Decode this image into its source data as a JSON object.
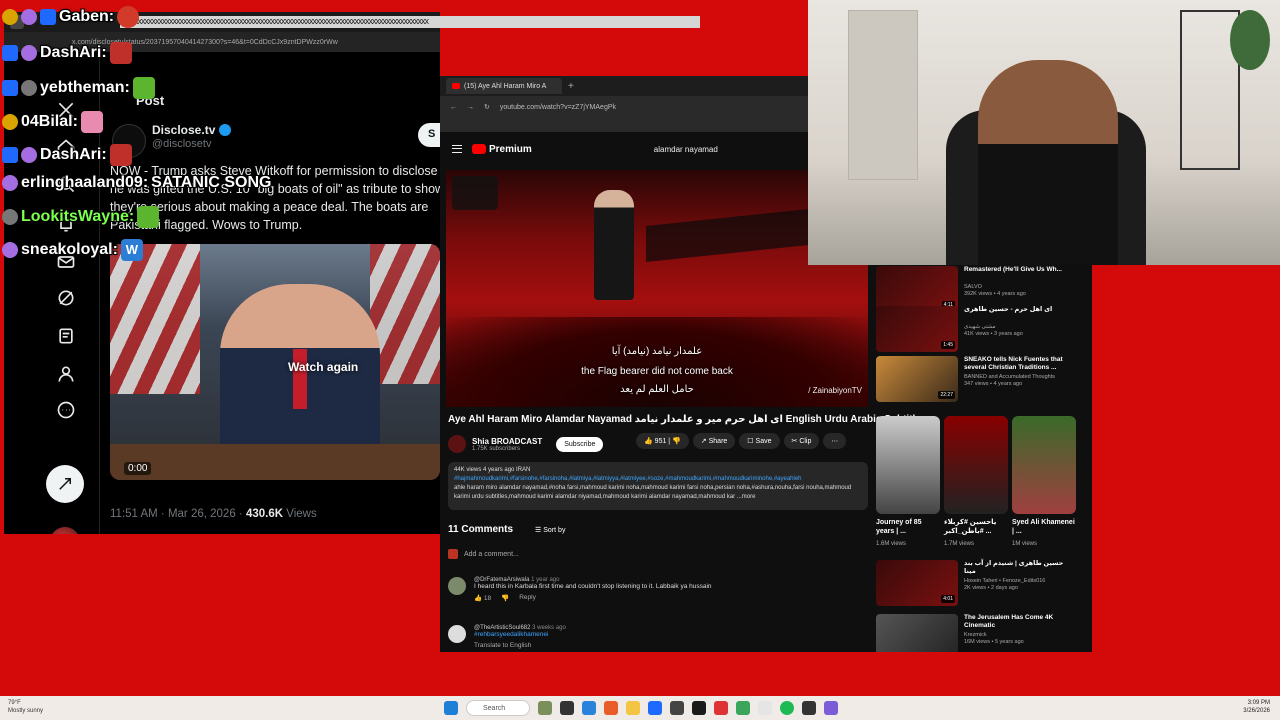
{
  "x": {
    "address": "x.com/disclosetv/status/2037195704041427300?s=46&t=0CdDcCJx9zntDPWzz0rWw",
    "post_title": "Post",
    "author_name": "Disclose.tv",
    "author_handle": "@disclosetv",
    "subscribe_label": "S",
    "text": "NOW - Trump asks Steve Witkoff for permission to disclose he was gifted the U.S. 10 \"big boats of oil\" as tribute to show they're serious about making a peace deal. The boats are Pakistani flagged. Wows to Trump.",
    "media_overlay": "Watch again",
    "media_time": "0:00",
    "timestamp": "11:51 AM · Mar 26, 2026 · ",
    "views_count": "430.6K",
    "views_label": " Views"
  },
  "chat": [
    {
      "name": "Gaben:",
      "color": "#ffffff",
      "msg": ""
    },
    {
      "name": "DashAri:",
      "color": "#ffffff",
      "msg": ""
    },
    {
      "name": "yebtheman:",
      "color": "#ffffff",
      "msg": ""
    },
    {
      "name": "04Bilal:",
      "color": "#ffffff",
      "msg": ""
    },
    {
      "name": "DashAri:",
      "color": "#ffffff",
      "msg": ""
    },
    {
      "name": "erlinghaaland09:",
      "color": "#ffffff",
      "msg": "SATANIC SONG"
    },
    {
      "name": "LookitsWayne:",
      "color": "#7cff4f",
      "msg": ""
    },
    {
      "name": "sneakoloyal:",
      "color": "#ffffff",
      "msg": ""
    }
  ],
  "youtube": {
    "tab_label": "(15) Aye Ahl Haram Miro A",
    "address": "youtube.com/watch?v=zZ7jYMAegPk",
    "premium": "Premium",
    "search_value": "alamdar nayamad",
    "subtitle_ar1": "علمدار نیامد (نیامد) آیا",
    "subtitle_en": "the Flag bearer did not come back",
    "subtitle_ar2": "حامل العلم لم يعد",
    "watermark": "/ ZainabiyonTV",
    "title": "Aye Ahl Haram Miro Alamdar Nayamad ای اهل حرم میر و علمدار نیامد English Urdu Arabic Subtitles",
    "channel": "Shia BROADCAST",
    "subs": "1.75K subscribers",
    "subscribe": "Subscribe",
    "likes": "951",
    "share": "Share",
    "save": "Save",
    "clip": "Clip",
    "desc_meta": "44K views  4 years ago  IRAN",
    "desc_tags": "#hajmahmoudkarimi,#farsinohe,#farsinoha,#latmiya,#latmiyya,#latmiyee,#soze,#mahmoudkarimi,#mahmoudkariminohe,#ayeahleh",
    "desc_text": "ahle haram miro alamdar nayamad,#noha farsi,mahmoud karimi noha,mahmoud karimi farsi noha,persian noha,#ashura,nouha,farsi nouha,mahmoud karimi urdu subtitles,mahmoud karimi alamdar niyamad,mahmoud karimi alamdar nayamad,mahmoud kar ...more",
    "comments_count": "11 Comments",
    "sort_by": "Sort by",
    "add_comment": "Add a comment...",
    "comments": [
      {
        "user": "@DrFatemaArsiwala",
        "when": "1 year ago",
        "text": "I heard this in Karbala first time and couldn't stop listening to it. Labbaik ya hussain",
        "likes": "18",
        "reply": "Reply"
      },
      {
        "user": "@TheArtisticSoul682",
        "when": "3 weeks ago",
        "text": "#rehbarsyeedalikhamenei",
        "likes": "",
        "reply": "Translate to English"
      }
    ],
    "recs": [
      {
        "title": "Remastered (He'll Give Us Wh...",
        "meta1": "SALVO",
        "meta2": "392K views • 4 years ago",
        "dur": "4:11"
      },
      {
        "title": "ای اهل حرم - حسین طاهری",
        "meta1": "مشتی شهیدی",
        "meta2": "41K views • 3 years ago",
        "dur": "1:45"
      },
      {
        "title": "SNEAKO tells Nick Fuentes that several Christian Traditions ...",
        "meta1": "BANNED and Accumulated Thoughts",
        "meta2": "347 views • 4 years ago",
        "dur": "22:27"
      },
      {
        "title": "حسین طاهری | شنیدم از آب بند مینا",
        "meta1": "Hosein Taheri • Fenoze_Edits016",
        "meta2": "2K views • 2 days ago",
        "dur": "4:01"
      },
      {
        "title": "The Jerusalem Has Come 4K Cinematic",
        "meta1": "Krezmick",
        "meta2": "16M views • 5 years ago",
        "dur": ""
      }
    ],
    "shorts": [
      {
        "title": "Journey of 85 years | ...",
        "views": "1.6M views"
      },
      {
        "title": "یاحسین #کربلاء #باطن_اکبر ...",
        "views": "1.7M views"
      },
      {
        "title": "Syed Ali Khamenei | ...",
        "views": "1M views"
      }
    ]
  },
  "taskbar": {
    "weather_temp": "79°F",
    "weather_desc": "Mostly sunny",
    "search": "Search",
    "time": "3:09 PM",
    "date": "3/26/2026"
  }
}
